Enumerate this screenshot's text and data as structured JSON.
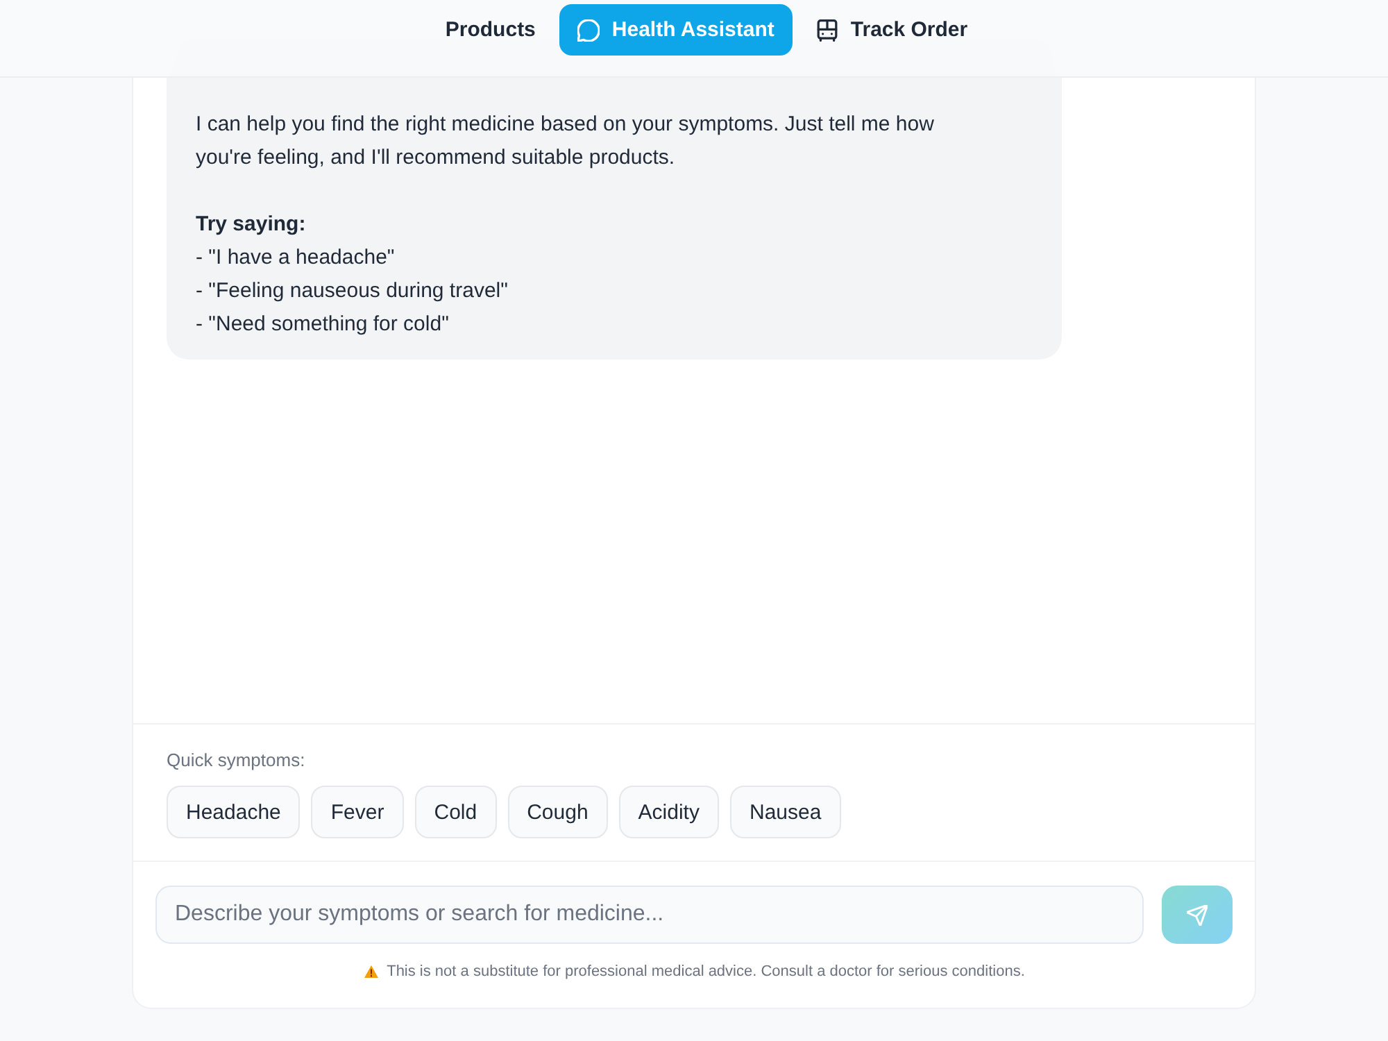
{
  "nav": {
    "items": [
      {
        "label": "Products",
        "kind": "text",
        "selected": false
      },
      {
        "label": "Health Assistant",
        "kind": "chat",
        "selected": true
      },
      {
        "label": "Track Order",
        "kind": "bus",
        "selected": false
      }
    ]
  },
  "chat": {
    "messages": [
      {
        "kind": "bot",
        "text": "I can help you find the right medicine based on your symptoms. Just tell me how you're feeling, and I'll recommend suitable products.\n\n**Try saying:**\n- \"I have a headache\"\n- \"Feeling nauseous during travel\"\n- \"Need something for cold\""
      }
    ]
  },
  "quick_symptoms": {
    "label": "Quick symptoms:",
    "chips": [
      "Headache",
      "Fever",
      "Cold",
      "Cough",
      "Acidity",
      "Nausea"
    ]
  },
  "composer": {
    "placeholder": "Describe your symptoms or search for medicine...",
    "send_button": {
      "disabled": true
    }
  },
  "disclaimer": "This is not a substitute for professional medical advice. Consult a doctor for serious conditions."
}
